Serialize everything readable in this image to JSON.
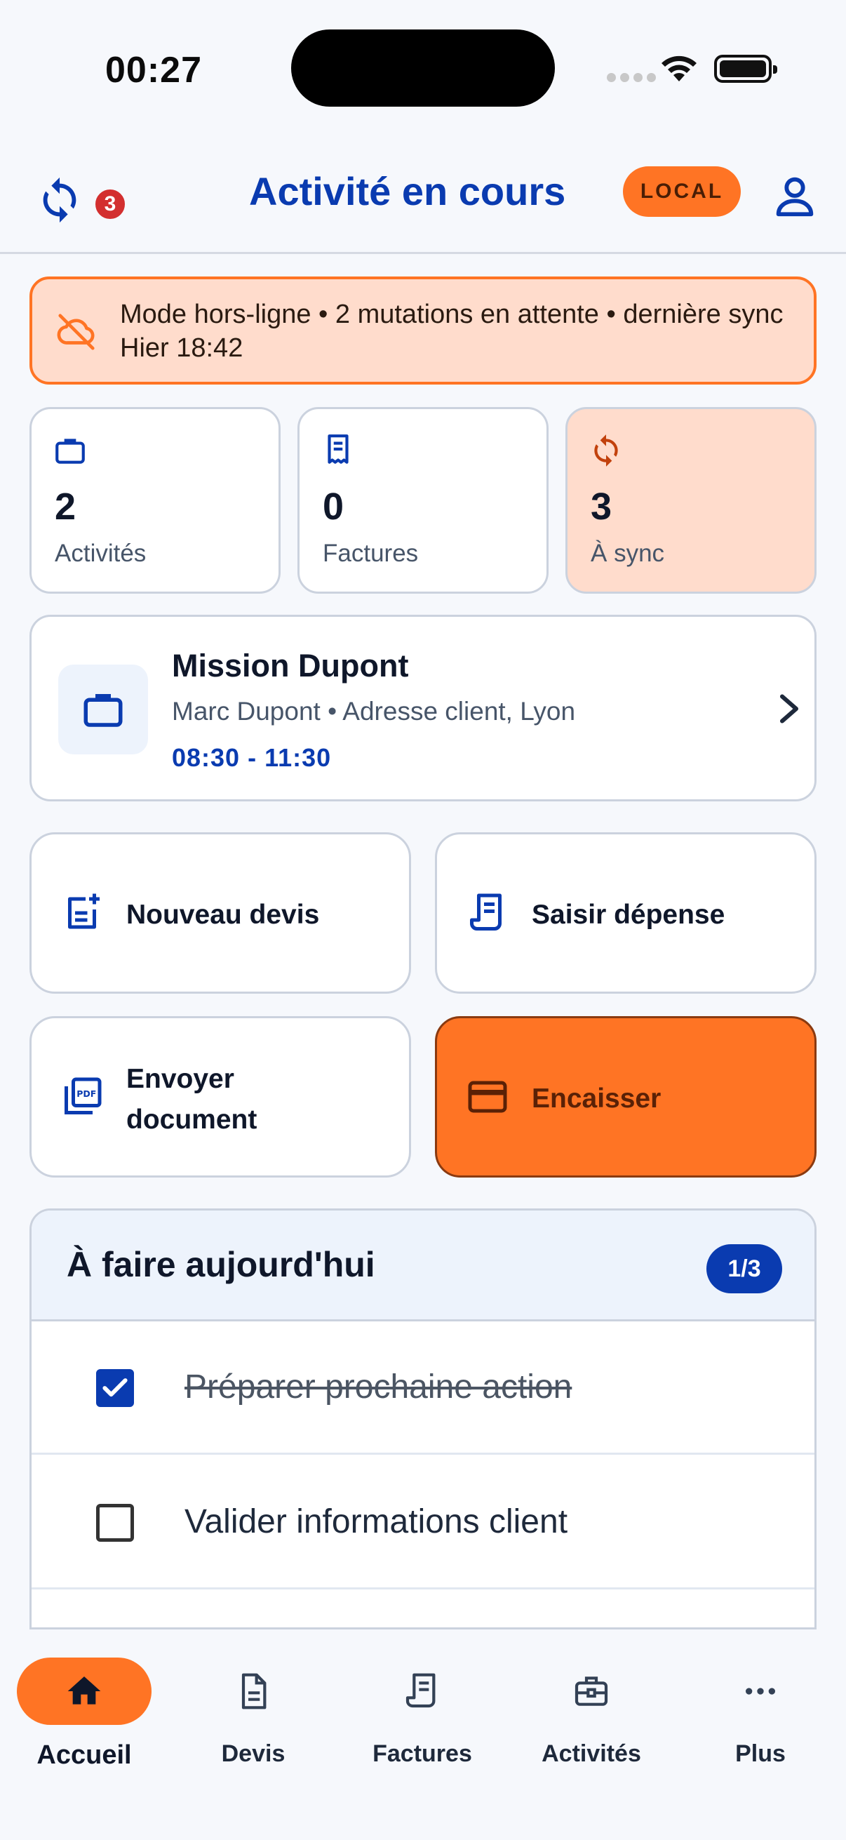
{
  "status_bar": {
    "time": "00:27"
  },
  "header": {
    "title": "Activité en cours",
    "sync_pending_count": "3",
    "env_badge": "LOCAL"
  },
  "offline_banner": {
    "text": "Mode hors-ligne • 2 mutations en attente • dernière sync Hier 18:42"
  },
  "stats": [
    {
      "value": "2",
      "label": "Activités",
      "icon": "briefcase-icon"
    },
    {
      "value": "0",
      "label": "Factures",
      "icon": "receipt-icon"
    },
    {
      "value": "3",
      "label": "À sync",
      "icon": "sync-icon"
    }
  ],
  "activity": {
    "title": "Mission Dupont",
    "subtitle": "Marc Dupont • Adresse client, Lyon",
    "time": "08:30 - 11:30"
  },
  "actions": {
    "new_quote": "Nouveau devis",
    "enter_expense": "Saisir dépense",
    "send_document_line1": "Envoyer",
    "send_document_line2": "document",
    "collect_payment": "Encaisser"
  },
  "todo": {
    "title": "À faire aujourd'hui",
    "count": "1/3",
    "items": [
      {
        "text": "Préparer prochaine action",
        "done": true
      },
      {
        "text": "Valider informations client",
        "done": false
      }
    ]
  },
  "nav": {
    "items": [
      {
        "label": "Accueil",
        "icon": "home-icon",
        "active": true
      },
      {
        "label": "Devis",
        "icon": "document-icon"
      },
      {
        "label": "Factures",
        "icon": "receipt-icon"
      },
      {
        "label": "Activités",
        "icon": "toolbox-icon"
      },
      {
        "label": "Plus",
        "icon": "more-icon"
      }
    ]
  },
  "colors": {
    "primary_blue": "#0a3bb0",
    "accent_orange": "#ff7424",
    "warning_bg": "#ffdccc",
    "badge_red": "#d32f2f"
  }
}
